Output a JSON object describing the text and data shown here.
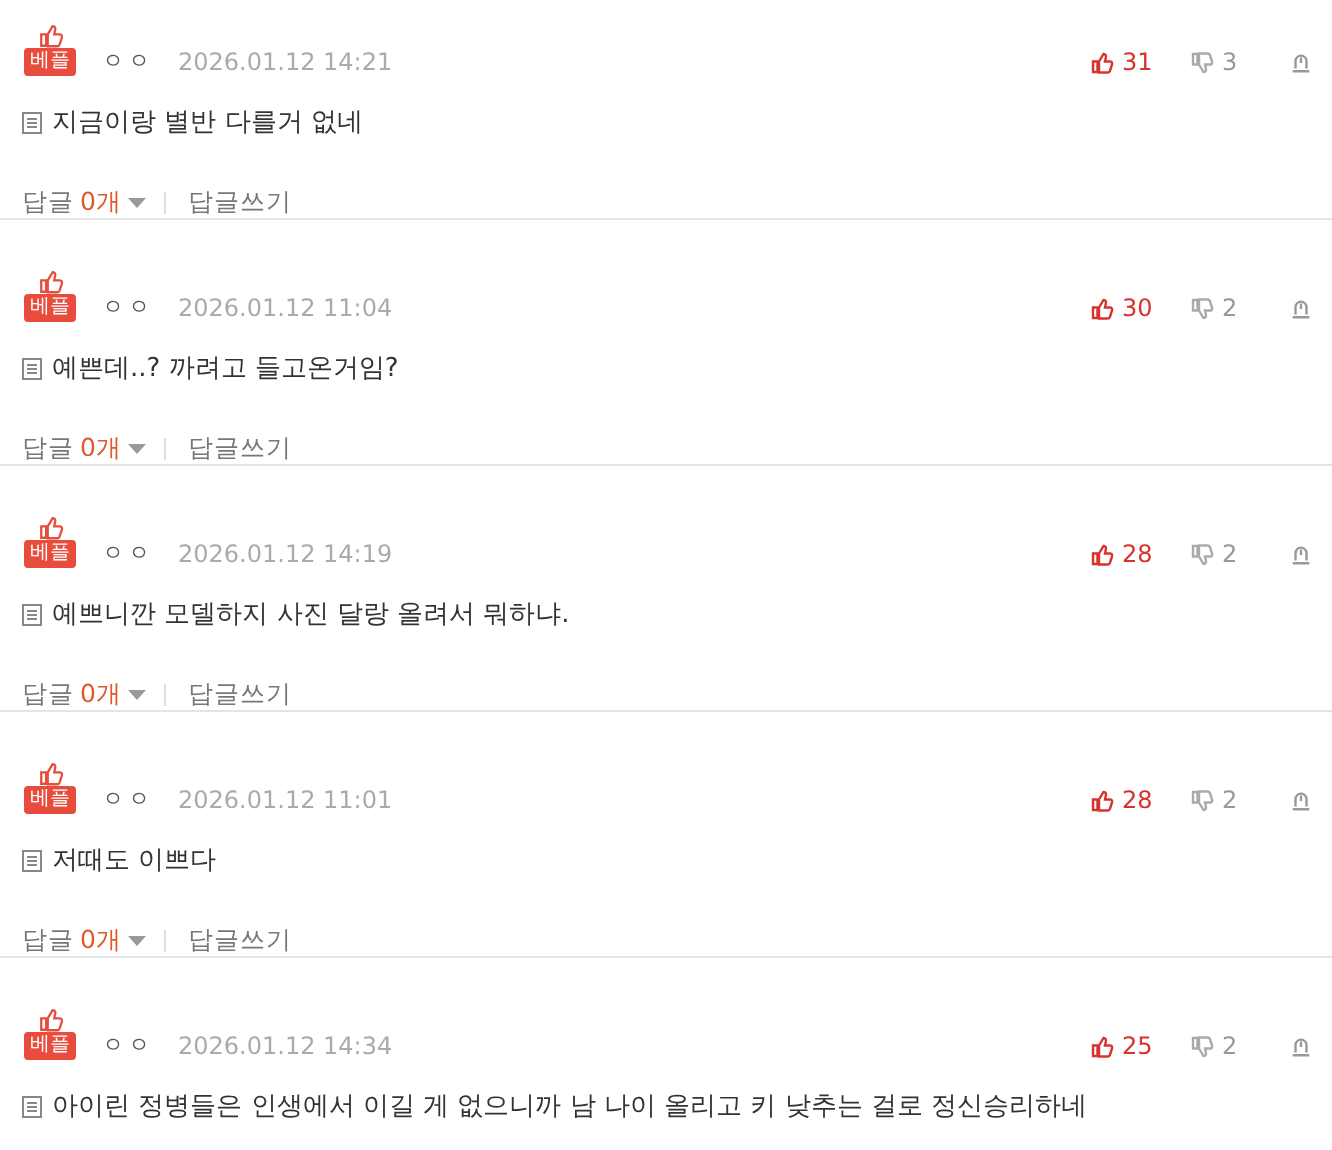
{
  "comments": [
    {
      "badge": "베플",
      "author": "ㅇㅇ",
      "date": "2026.01.12 14:21",
      "text": "지금이랑 별반 다를거 없네",
      "likes": "31",
      "dislikes": "3",
      "reply_label": "답글",
      "reply_count": "0개",
      "write_reply": "답글쓰기"
    },
    {
      "badge": "베플",
      "author": "ㅇㅇ",
      "date": "2026.01.12 11:04",
      "text": "예쁜데..? 까려고 들고온거임?",
      "likes": "30",
      "dislikes": "2",
      "reply_label": "답글",
      "reply_count": "0개",
      "write_reply": "답글쓰기"
    },
    {
      "badge": "베플",
      "author": "ㅇㅇ",
      "date": "2026.01.12 14:19",
      "text": "예쁘니깐 모델하지 사진 달랑 올려서 뭐하냐.",
      "likes": "28",
      "dislikes": "2",
      "reply_label": "답글",
      "reply_count": "0개",
      "write_reply": "답글쓰기"
    },
    {
      "badge": "베플",
      "author": "ㅇㅇ",
      "date": "2026.01.12 11:01",
      "text": "저때도 이쁘다",
      "likes": "28",
      "dislikes": "2",
      "reply_label": "답글",
      "reply_count": "0개",
      "write_reply": "답글쓰기"
    },
    {
      "badge": "베플",
      "author": "ㅇㅇ",
      "date": "2026.01.12 14:34",
      "text": "아이린 정병들은 인생에서 이길 게 없으니까 남 나이 올리고 키 낮추는 걸로 정신승리하네",
      "likes": "25",
      "dislikes": "2"
    }
  ]
}
